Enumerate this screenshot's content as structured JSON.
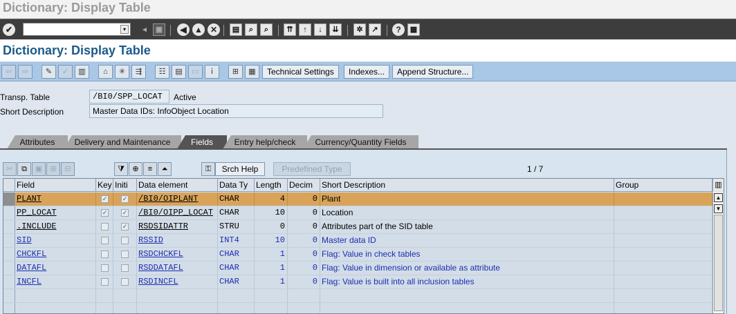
{
  "window": {
    "title": "Dictionary: Display Table"
  },
  "app": {
    "title": "Dictionary: Display Table"
  },
  "toolbar": {
    "technical_settings": "Technical Settings",
    "indexes": "Indexes...",
    "append_structure": "Append Structure..."
  },
  "header": {
    "transp_table_label": "Transp. Table",
    "transp_table_value": "/BI0/SPP_LOCAT",
    "status": "Active",
    "short_desc_label": "Short Description",
    "short_desc_value": "Master Data IDs: InfoObject Location"
  },
  "tabs": [
    {
      "label": "Attributes",
      "active": false
    },
    {
      "label": "Delivery and Maintenance",
      "active": false
    },
    {
      "label": "Fields",
      "active": true
    },
    {
      "label": "Entry help/check",
      "active": false
    },
    {
      "label": "Currency/Quantity Fields",
      "active": false
    }
  ],
  "fields_toolbar": {
    "srch_help": "Srch Help",
    "predefined_type": "Predefined Type",
    "page_info": "1 / 7"
  },
  "table": {
    "columns": [
      "Field",
      "Key",
      "Initi",
      "Data element",
      "Data Ty",
      "Length",
      "Decim",
      "Short Description",
      "Group"
    ],
    "rows": [
      {
        "field": "PLANT",
        "key": true,
        "init": true,
        "data_element": "/BI0/OIPLANT",
        "data_type": "CHAR",
        "length": "4",
        "decimals": "0",
        "description": "Plant",
        "group": "",
        "selected": true,
        "blue": false
      },
      {
        "field": "PP_LOCAT",
        "key": true,
        "init": true,
        "data_element": "/BI0/OIPP_LOCAT",
        "data_type": "CHAR",
        "length": "10",
        "decimals": "0",
        "description": "Location",
        "group": "",
        "selected": false,
        "blue": false
      },
      {
        "field": ".INCLUDE",
        "key": false,
        "init": true,
        "data_element": "RSDSIDATTR",
        "data_type": "STRU",
        "length": "0",
        "decimals": "0",
        "description": "Attributes part of the SID table",
        "group": "",
        "selected": false,
        "blue": false
      },
      {
        "field": "SID",
        "key": false,
        "init": false,
        "data_element": "RSSID",
        "data_type": "INT4",
        "length": "10",
        "decimals": "0",
        "description": "Master data ID",
        "group": "",
        "selected": false,
        "blue": true
      },
      {
        "field": "CHCKFL",
        "key": false,
        "init": false,
        "data_element": "RSDCHCKFL",
        "data_type": "CHAR",
        "length": "1",
        "decimals": "0",
        "description": "Flag: Value in check tables",
        "group": "",
        "selected": false,
        "blue": true
      },
      {
        "field": "DATAFL",
        "key": false,
        "init": false,
        "data_element": "RSDDATAFL",
        "data_type": "CHAR",
        "length": "1",
        "decimals": "0",
        "description": "Flag: Value in dimension or available as attribute",
        "group": "",
        "selected": false,
        "blue": true
      },
      {
        "field": "INCFL",
        "key": false,
        "init": false,
        "data_element": "RSDINCFL",
        "data_type": "CHAR",
        "length": "1",
        "decimals": "0",
        "description": "Flag: Value is built into all inclusion tables",
        "group": "",
        "selected": false,
        "blue": true
      }
    ]
  },
  "colors": {
    "accent": "#1b5a8a",
    "toolbar": "#a9c7e6",
    "selected_row": "#d9a45a",
    "link": "#1b2fb0"
  }
}
